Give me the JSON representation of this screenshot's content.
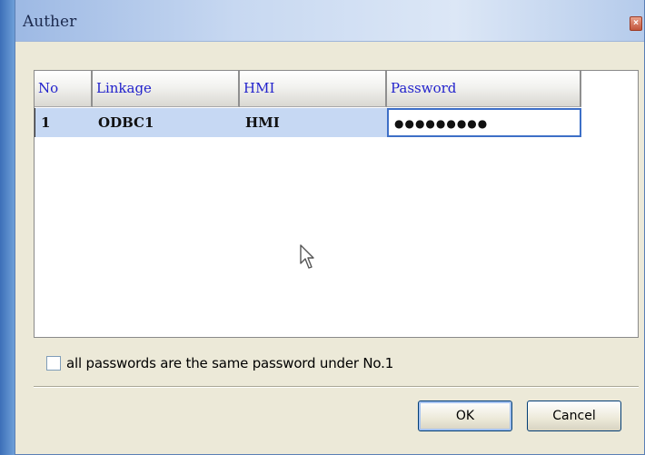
{
  "window": {
    "title": "Auther",
    "close_glyph": "×"
  },
  "grid": {
    "columns": [
      "No",
      "Linkage",
      "HMI",
      "Password"
    ],
    "rows": [
      {
        "no": "1",
        "linkage": "ODBC1",
        "hmi": "HMI",
        "password": "●●●●●●●●●"
      }
    ]
  },
  "options": {
    "same_password_label": "all passwords are the same password under No.1",
    "same_password_checked": false
  },
  "buttons": {
    "ok_label": "OK",
    "cancel_label": "Cancel"
  },
  "colors": {
    "header_text": "#2222cc",
    "selection": "#c6d8f3",
    "focus_border": "#3d6fc7"
  },
  "icons": {
    "close": "close-icon",
    "cursor": "mouse-cursor-icon"
  }
}
